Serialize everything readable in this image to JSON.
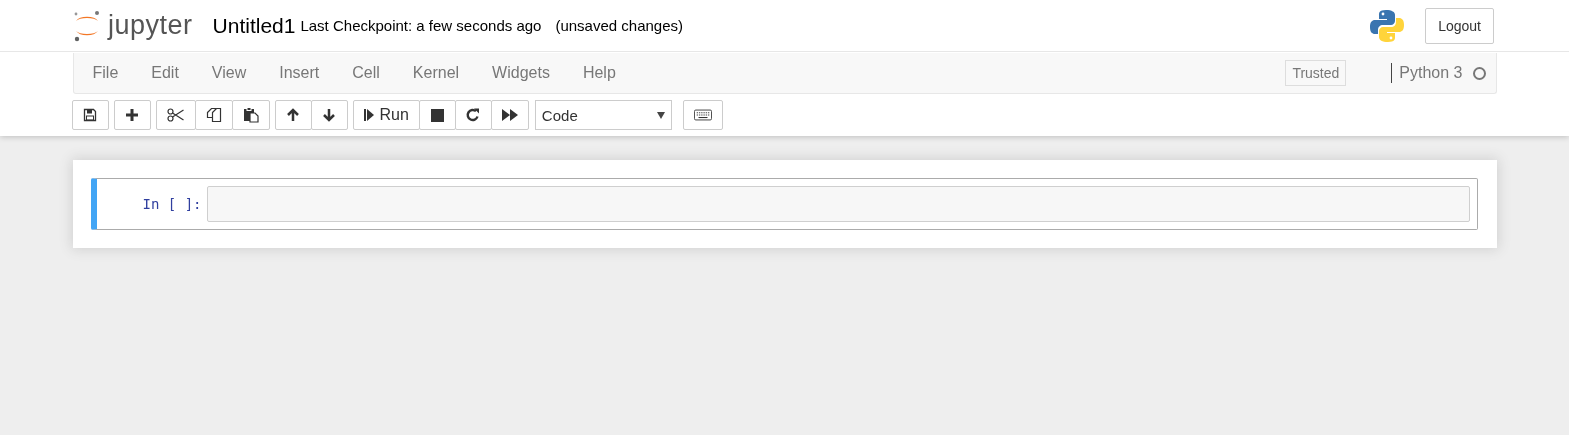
{
  "header": {
    "logo_text": "jupyter",
    "notebook_name": "Untitled1",
    "checkpoint": "Last Checkpoint: a few seconds ago",
    "autosave_status": "(unsaved changes)",
    "logout": "Logout"
  },
  "menubar": {
    "items": [
      "File",
      "Edit",
      "View",
      "Insert",
      "Cell",
      "Kernel",
      "Widgets",
      "Help"
    ],
    "trusted": "Trusted",
    "kernel_name": "Python 3",
    "kernel_busy": false
  },
  "toolbar": {
    "groups": [
      [
        {
          "kind": "save"
        }
      ],
      [
        {
          "kind": "add"
        }
      ],
      [
        {
          "kind": "cut"
        },
        {
          "kind": "copy"
        },
        {
          "kind": "paste"
        }
      ],
      [
        {
          "kind": "up"
        },
        {
          "kind": "down"
        }
      ],
      [
        {
          "kind": "run",
          "label": "Run"
        },
        {
          "kind": "stop"
        },
        {
          "kind": "restart"
        },
        {
          "kind": "forward"
        }
      ]
    ],
    "cell_type": "Code"
  },
  "cells": [
    {
      "prompt": "In [ ]:",
      "selected": true
    }
  ]
}
